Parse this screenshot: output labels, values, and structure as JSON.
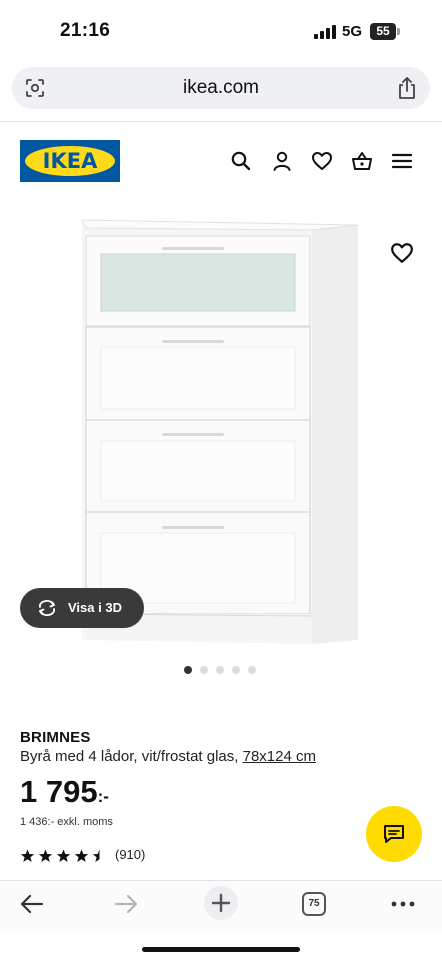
{
  "status_bar": {
    "time": "21:16",
    "network": "5G",
    "battery": "55"
  },
  "browser": {
    "url": "ikea.com",
    "left_icon": "lens-icon",
    "right_icon": "share-icon"
  },
  "header": {
    "logo_text": "IKEA",
    "icons": [
      "search-icon",
      "user-icon",
      "heart-icon",
      "basket-icon",
      "menu-icon"
    ],
    "brand_colors": {
      "blue": "#0058a3",
      "yellow": "#ffda1a"
    }
  },
  "gallery": {
    "view_3d_label": "Visa i 3D",
    "image_count": 5,
    "active_index": 0
  },
  "product": {
    "name": "BRIMNES",
    "description": "Byrå med 4 lådor, vit/frostat glas, ",
    "size": "78x124 cm",
    "price_main": "1 795",
    "price_suffix": ":-",
    "price_excl_vat": "1 436:- exkl. moms",
    "rating": 4.5,
    "rating_max": 5,
    "review_count": "(910)"
  },
  "chat": {
    "icon": "chat-icon",
    "color": "#ffdb00"
  },
  "bottom_bar": {
    "tab_count": "75",
    "icons": [
      "back-arrow-icon",
      "forward-arrow-icon",
      "plus-icon",
      "tabs-icon",
      "more-icon"
    ]
  }
}
